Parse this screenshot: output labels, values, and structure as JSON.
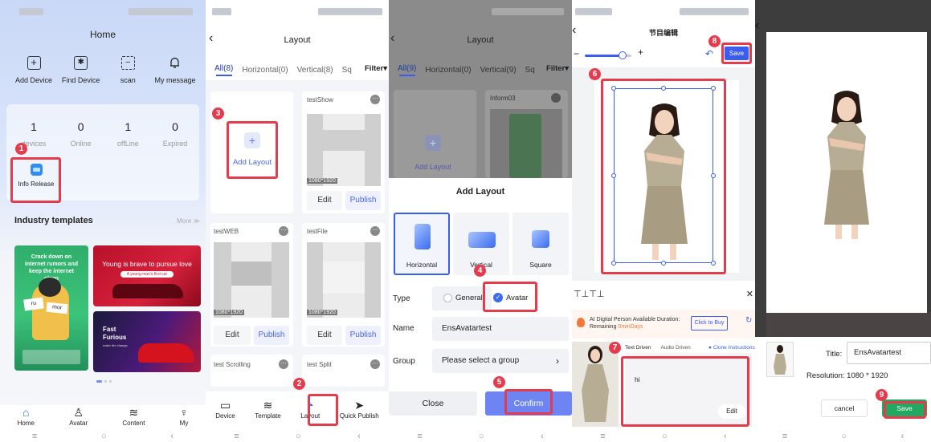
{
  "panel1": {
    "title": "Home",
    "actions": [
      {
        "label": "Add Device",
        "icon": "plus-square-icon"
      },
      {
        "label": "Find Device",
        "icon": "bluetooth-icon"
      },
      {
        "label": "scan",
        "icon": "scan-icon"
      },
      {
        "label": "My message",
        "icon": "bell-icon"
      }
    ],
    "stats": [
      {
        "value": "1",
        "label": "devices"
      },
      {
        "value": "0",
        "label": "Online"
      },
      {
        "value": "1",
        "label": "offLine"
      },
      {
        "value": "0",
        "label": "Expired"
      }
    ],
    "info_release": "Info Release",
    "industry_title": "Industry templates",
    "more": "More ≫",
    "template1_text": "Crack down on internet rumors and keep the internet clean",
    "template2_text": "Young is brave to pursue love",
    "template2_sub": "A young man's first car",
    "template3_text": "Fast Furious",
    "template3_sub": "make the change",
    "nav": [
      {
        "label": "Home",
        "icon": "home-icon"
      },
      {
        "label": "Avatar",
        "icon": "avatar-icon"
      },
      {
        "label": "Content",
        "icon": "layers-icon"
      },
      {
        "label": "My",
        "icon": "user-icon"
      }
    ],
    "step1": "1"
  },
  "panel2": {
    "title": "Layout",
    "tabs": [
      "All(8)",
      "Horizontal(0)",
      "Vertical(8)",
      "Sq"
    ],
    "filter": "Filter",
    "add_layout": "Add Layout",
    "cards": [
      {
        "name": "testShow",
        "size": "1080*1920",
        "edit": "Edit",
        "publish": "Publish"
      },
      {
        "name": "testWEB",
        "size": "1080*1920",
        "edit": "Edit",
        "publish": "Publish"
      },
      {
        "name": "testFile",
        "size": "1080*1920",
        "edit": "Edit",
        "publish": "Publish"
      },
      {
        "name": "test Scrolling"
      },
      {
        "name": "test Split"
      }
    ],
    "nav": [
      {
        "label": "Device",
        "icon": "device-icon"
      },
      {
        "label": "Template",
        "icon": "template-icon"
      },
      {
        "label": "Layout",
        "icon": "layout-icon"
      },
      {
        "label": "Quick Publish",
        "icon": "send-icon"
      }
    ],
    "step2": "2",
    "step3": "3"
  },
  "panel3": {
    "title": "Layout",
    "tabs": [
      "All(9)",
      "Horizontal(0)",
      "Vertical(9)",
      "Sq"
    ],
    "filter": "Filter",
    "bg_card": "Inform03",
    "bg_add": "Add Layout",
    "dialog_title": "Add Layout",
    "orientations": [
      "Horizontal",
      "Vertical",
      "Square"
    ],
    "type_label": "Type",
    "type_general": "General",
    "type_avatar": "Avatar",
    "name_label": "Name",
    "name_value": "EnsAvatartest",
    "group_label": "Group",
    "group_placeholder": "Please select a group",
    "close": "Close",
    "confirm": "Confirm",
    "step4": "4",
    "step5": "5"
  },
  "panel4": {
    "title": "节目编辑",
    "save": "Save",
    "ai_text": "AI Digital Person Available Duration: Remaining",
    "ai_remaining": "0minDays",
    "click_to_buy": "Click to Buy",
    "tabs": [
      "Text Driven",
      "Audio Driven"
    ],
    "clone": "Clone Instructions",
    "text_content": "hi",
    "edit": "Edit",
    "step6": "6",
    "step7": "7",
    "step8": "8"
  },
  "panel5": {
    "title_label": "Title:",
    "title_value": "EnsAvatartest",
    "resolution_label": "Resolution:",
    "resolution_value": "1080 * 1920",
    "cancel": "cancel",
    "save": "Save",
    "step9": "9"
  },
  "colors": {
    "accent": "#3a5cf0",
    "red": "#e43b4d",
    "green": "#23a861",
    "dark_overlay": "#3d3d3d"
  }
}
